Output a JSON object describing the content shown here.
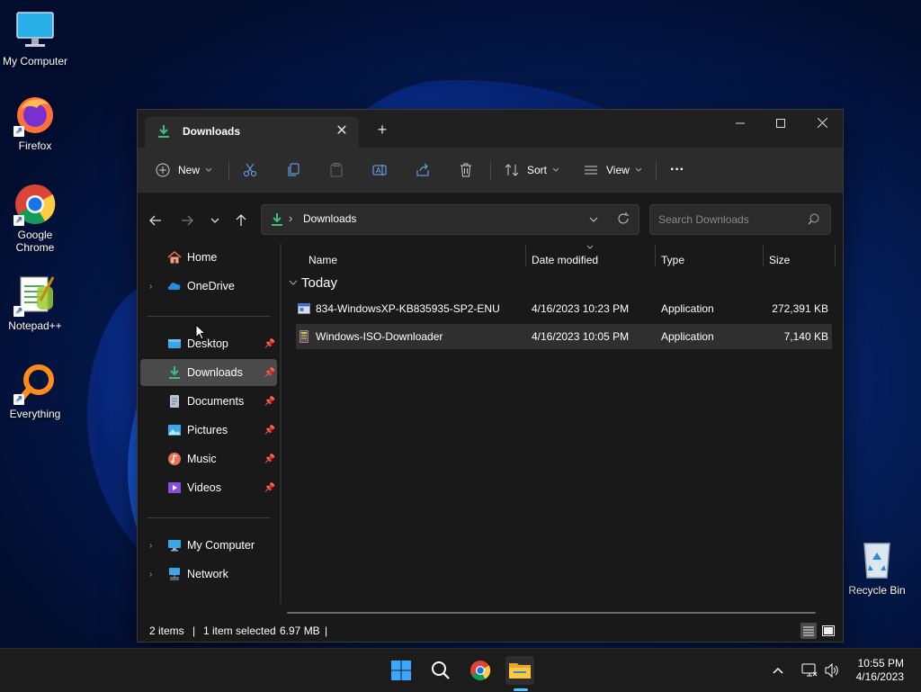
{
  "desktop": {
    "icons": [
      {
        "label": "My Computer"
      },
      {
        "label": "Firefox"
      },
      {
        "label": "Google Chrome"
      },
      {
        "label": "Notepad++"
      },
      {
        "label": "Everything"
      },
      {
        "label": "Recycle Bin"
      }
    ]
  },
  "explorer": {
    "tab_title": "Downloads",
    "tab_close": "✕",
    "new_tab": "+",
    "window_controls": {
      "minimize": "—",
      "maximize": "☐",
      "close": "✕"
    },
    "toolbar": {
      "new_label": "New",
      "sort_label": "Sort",
      "view_label": "View",
      "more_label": "···"
    },
    "address": {
      "separator": "›",
      "location": "Downloads",
      "search_placeholder": "Search Downloads"
    },
    "sidebar": {
      "items": [
        {
          "label": "Home",
          "icon": "home-icon"
        },
        {
          "label": "OneDrive",
          "icon": "onedrive-icon"
        },
        {
          "label": "Desktop",
          "icon": "desktop-folder-icon",
          "pinned": true
        },
        {
          "label": "Downloads",
          "icon": "downloads-icon",
          "pinned": true,
          "selected": true
        },
        {
          "label": "Documents",
          "icon": "documents-icon",
          "pinned": true
        },
        {
          "label": "Pictures",
          "icon": "pictures-icon",
          "pinned": true
        },
        {
          "label": "Music",
          "icon": "music-icon",
          "pinned": true
        },
        {
          "label": "Videos",
          "icon": "videos-icon",
          "pinned": true
        },
        {
          "label": "My Computer",
          "icon": "computer-icon"
        },
        {
          "label": "Network",
          "icon": "network-icon"
        }
      ]
    },
    "columns": {
      "name": "Name",
      "date": "Date modified",
      "type": "Type",
      "size": "Size"
    },
    "group_label": "Today",
    "files": [
      {
        "name": "834-WindowsXP-KB835935-SP2-ENU",
        "date": "4/16/2023 10:23 PM",
        "type": "Application",
        "size": "272,391 KB"
      },
      {
        "name": "Windows-ISO-Downloader",
        "date": "4/16/2023 10:05 PM",
        "type": "Application",
        "size": "7,140 KB"
      }
    ],
    "status": {
      "items": "2 items",
      "selected": "1 item selected",
      "selected_size": "6.97 MB",
      "divider": "|"
    }
  },
  "taskbar": {
    "time": "10:55 PM",
    "date": "4/16/2023"
  },
  "colors": {
    "accent": "#4cc2ff",
    "window_bg": "#191919",
    "selected_row": "#2f2f2f",
    "selected_nav": "#4a4a4a"
  }
}
